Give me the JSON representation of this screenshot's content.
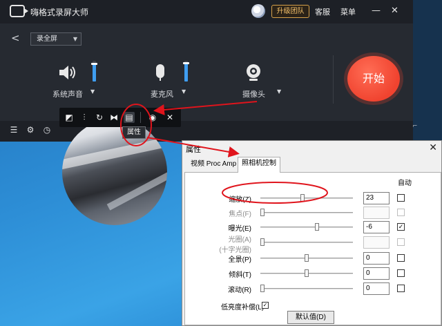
{
  "app": {
    "title": "嗨格式录屏大师",
    "upgrade_label": "升级团队",
    "service_label": "客服",
    "menu_label": "菜单",
    "minimize": "—",
    "close": "✕",
    "back": "<",
    "mode": "录全屏",
    "sources": [
      {
        "label": "系统声音",
        "icon": "speaker-icon",
        "level": 0.85
      },
      {
        "label": "麦克风",
        "icon": "microphone-icon",
        "level": 0.9
      },
      {
        "label": "摄像头",
        "icon": "camera-icon"
      }
    ],
    "start_label": "开始",
    "bottom_icons": [
      "list-icon",
      "settings-icon",
      "timer-icon"
    ]
  },
  "camera_toolbar": {
    "tools": [
      "shape-icon",
      "adjust-icon",
      "rotate-icon",
      "flip-icon",
      "properties-icon",
      "hide-icon",
      "close-icon"
    ],
    "tooltip": "属性"
  },
  "dialog": {
    "title": "属性",
    "close": "✕",
    "tabs": [
      "视频 Proc Amp",
      "照相机控制"
    ],
    "active_tab": "照相机控制",
    "auto_header": "自动",
    "rows": [
      {
        "label": "缩放(Z)",
        "value": "23",
        "slider": 0.45,
        "auto": false,
        "enabled": true
      },
      {
        "label": "焦点(F)",
        "value": "",
        "slider": 0.0,
        "auto": false,
        "enabled": false
      },
      {
        "label": "曝光(E)",
        "value": "-6",
        "slider": 0.62,
        "auto": true,
        "enabled": true
      },
      {
        "label": "光圈(A)\n(十字光圈)",
        "value": "",
        "slider": 0.0,
        "auto": false,
        "enabled": false
      },
      {
        "label": "全景(P)",
        "value": "0",
        "slider": 0.5,
        "auto": false,
        "enabled": true
      },
      {
        "label": "倾斜(T)",
        "value": "0",
        "slider": 0.5,
        "auto": false,
        "enabled": true
      },
      {
        "label": "滚动(R)",
        "value": "0",
        "slider": 0.0,
        "auto": false,
        "enabled": true
      }
    ],
    "lowlight_label": "低亮度补偿(L)",
    "lowlight_checked": true,
    "default_button": "默认值(D)"
  },
  "colors": {
    "accent": "#3f9df0",
    "start": "#f0432f",
    "annotation": "#e0141c"
  }
}
